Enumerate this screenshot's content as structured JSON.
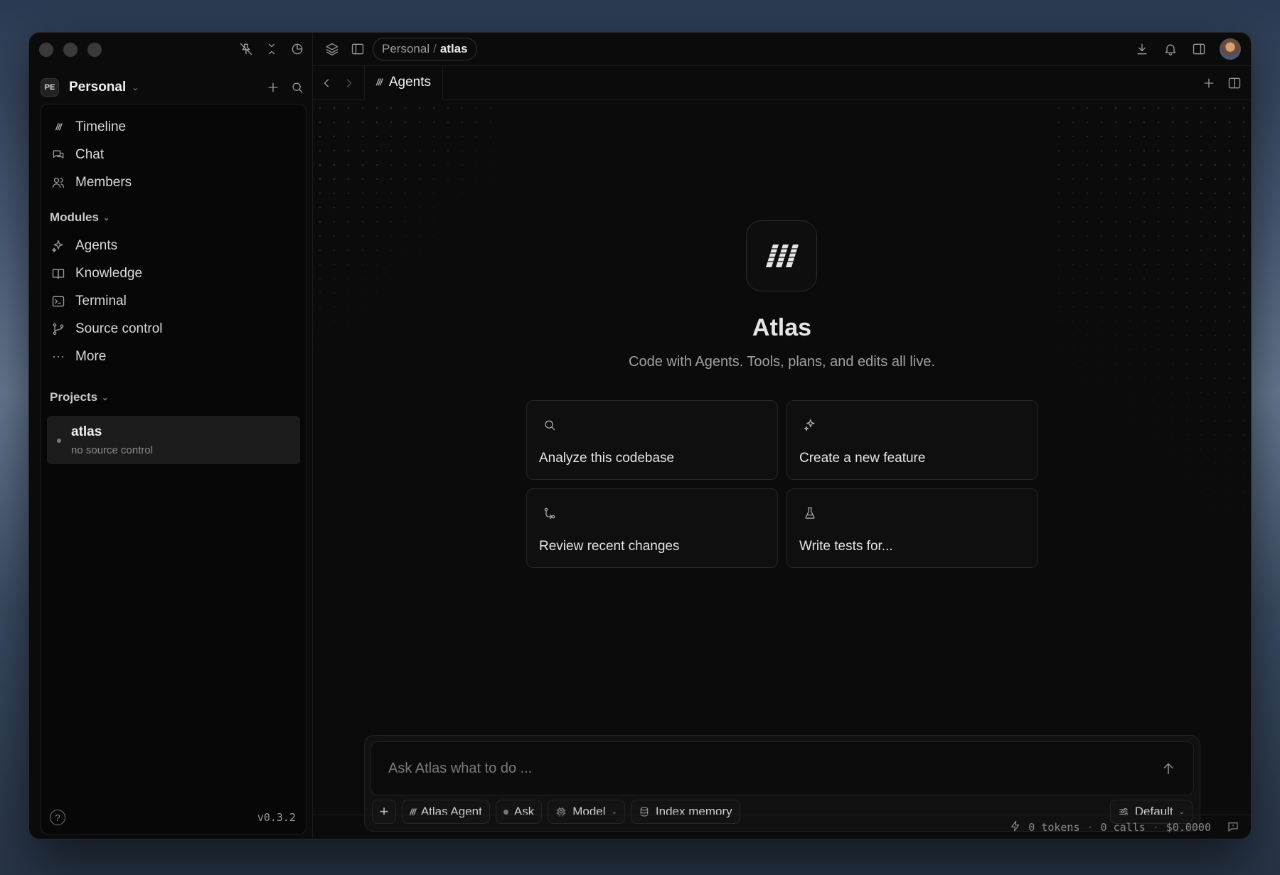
{
  "sidebar": {
    "workspace": {
      "badge": "PE",
      "name": "Personal"
    },
    "nav": [
      {
        "label": "Timeline",
        "icon": "timeline-icon"
      },
      {
        "label": "Chat",
        "icon": "chat-icon"
      },
      {
        "label": "Members",
        "icon": "members-icon"
      }
    ],
    "modules_label": "Modules",
    "modules": [
      {
        "label": "Agents",
        "icon": "sparkles-icon"
      },
      {
        "label": "Knowledge",
        "icon": "book-icon"
      },
      {
        "label": "Terminal",
        "icon": "terminal-icon"
      },
      {
        "label": "Source control",
        "icon": "git-branch-icon"
      },
      {
        "label": "More",
        "icon": "more-icon"
      }
    ],
    "projects_label": "Projects",
    "projects": [
      {
        "name": "atlas",
        "subtitle": "no source control"
      }
    ],
    "version": "v0.3.2"
  },
  "titlebar": {
    "breadcrumb": {
      "parent": "Personal",
      "separator": "/",
      "current": "atlas"
    }
  },
  "tab": {
    "label": "Agents"
  },
  "hero": {
    "title": "Atlas",
    "subtitle": "Code with Agents. Tools, plans, and edits all live."
  },
  "cards": [
    {
      "label": "Analyze this codebase",
      "icon": "search-icon"
    },
    {
      "label": "Create a new feature",
      "icon": "sparkles-icon"
    },
    {
      "label": "Review recent changes",
      "icon": "git-compare-icon"
    },
    {
      "label": "Write tests for...",
      "icon": "flask-icon"
    }
  ],
  "composer": {
    "placeholder": "Ask Atlas what to do ...",
    "chips": {
      "agent": "Atlas Agent",
      "mode": "Ask",
      "model": "Model",
      "memory": "Index memory",
      "preset": "Default"
    }
  },
  "status": {
    "tokens": "0 tokens",
    "calls": "0 calls",
    "cost": "$0.0000",
    "separator": "·"
  },
  "colors": {
    "background": "#0b0b0b",
    "panel": "#070707",
    "text": "#e8e8e8",
    "muted": "#9a9a9a"
  }
}
